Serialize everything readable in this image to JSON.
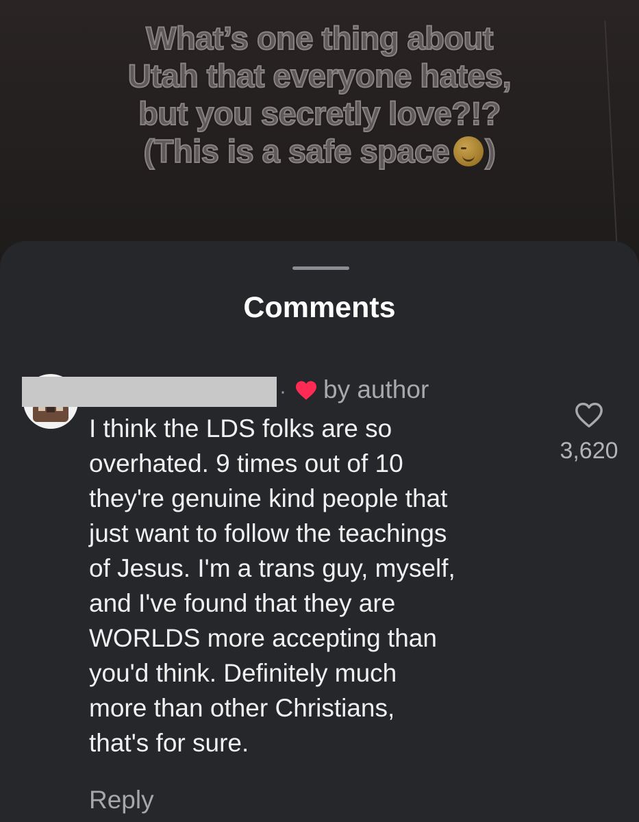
{
  "video_caption": {
    "lines": [
      "What’s one thing about",
      "Utah that everyone hates,",
      "but you secretly love?!?",
      "(This is a safe space"
    ],
    "closing": ")",
    "emoji": "winking-face-emoji"
  },
  "sheet": {
    "title": "Comments"
  },
  "comment": {
    "username": "",
    "separator": "·",
    "liked_by_author_label": "by author",
    "liked_by_author_icon": "red-heart-icon",
    "text_lines": [
      "I think the LDS folks are so",
      "overhated. 9 times out of 10",
      "they're genuine kind people that",
      "just want to follow the teachings",
      "of Jesus. I'm a trans guy, myself,",
      "and I've found that they are",
      "WORLDS more accepting than",
      "you'd think. Definitely much",
      "more than other Christians,",
      "that's for sure."
    ],
    "reply_label": "Reply",
    "like_icon": "heart-outline-icon",
    "like_count": "3,620"
  },
  "colors": {
    "sheet_background": "#25272b",
    "heart_red": "#ff2b55",
    "secondary_text": "#a7a9ad"
  }
}
